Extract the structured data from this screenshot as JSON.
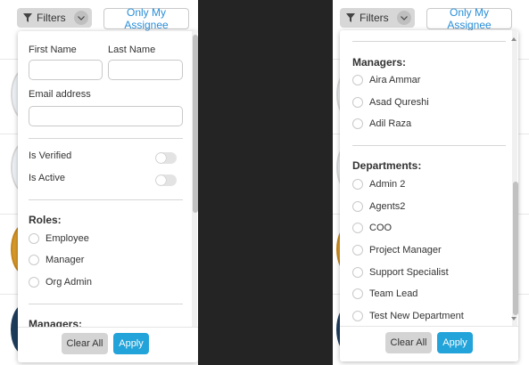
{
  "toolbar": {
    "filters_label": "Filters",
    "assignee_label": "Only My Assignee",
    "filter_icon": "funnel-icon",
    "chevron_icon": "chevron-down-icon"
  },
  "left_panel": {
    "first_name": {
      "label": "First Name",
      "value": ""
    },
    "last_name": {
      "label": "Last Name",
      "value": ""
    },
    "email": {
      "label": "Email address",
      "value": ""
    },
    "is_verified": {
      "label": "Is Verified",
      "on": false
    },
    "is_active": {
      "label": "Is Active",
      "on": false
    },
    "roles": {
      "title": "Roles:",
      "options": [
        "Employee",
        "Manager",
        "Org Admin"
      ]
    },
    "managers_title": "Managers:"
  },
  "right_panel": {
    "managers": {
      "title": "Managers:",
      "options": [
        "Aira Ammar",
        "Asad Qureshi",
        "Adil Raza"
      ]
    },
    "departments": {
      "title": "Departments:",
      "options": [
        "Admin 2",
        "Agents2",
        "COO",
        "Project Manager",
        "Support Specialist",
        "Team Lead",
        "Test New Department"
      ]
    }
  },
  "footer": {
    "clear_label": "Clear All",
    "apply_label": "Apply"
  },
  "colors": {
    "accent": "#22a3d9",
    "link": "#2a8fd8",
    "backdrop": "#242424"
  }
}
